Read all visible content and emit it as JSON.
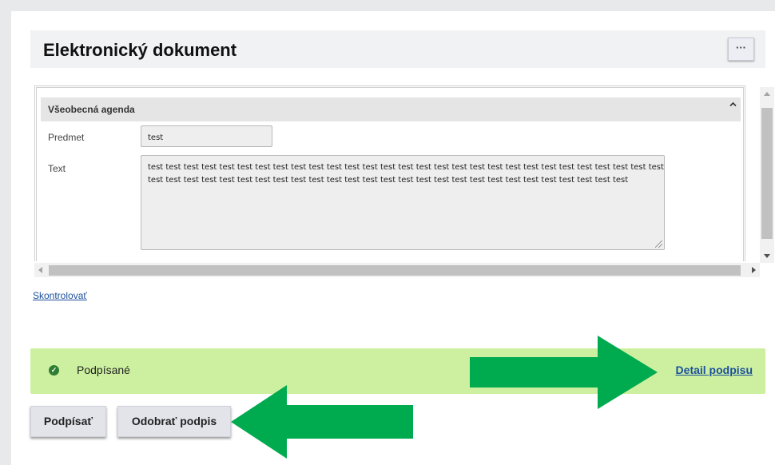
{
  "header": {
    "title": "Elektronický dokument",
    "more_label": "···"
  },
  "form": {
    "section_title": "Všeobecná agenda",
    "section_collapse_icon": "chevron-up-icon",
    "subject_label": "Predmet",
    "subject_value": "test",
    "text_label": "Text",
    "text_value": "test test test test test test test test test test test test test test test test test test test test test test test test test test test test test test test test test test test test test test test test test test test test test test test test test test test test test test test test"
  },
  "links": {
    "check": "Skontrolovať"
  },
  "status": {
    "icon": "check-circle-icon",
    "text": "Podpísané",
    "detail_link": "Detail podpisu",
    "background_color": "#cdf0a0"
  },
  "actions": {
    "sign_label": "Podpísať",
    "unsign_label": "Odobrať podpis"
  },
  "annotations": {
    "arrow_color": "#00aa4f",
    "arrow_to_detail": "arrow-right-icon",
    "arrow_to_unsign": "arrow-left-icon"
  }
}
